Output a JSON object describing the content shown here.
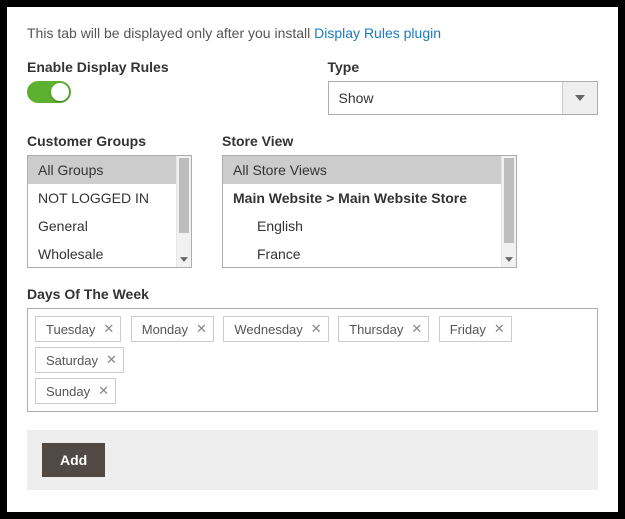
{
  "intro": {
    "text_before": "This tab will be displayed only after you install ",
    "link_text": "Display Rules plugin"
  },
  "enable": {
    "label": "Enable Display Rules"
  },
  "type": {
    "label": "Type",
    "value": "Show"
  },
  "customer_groups": {
    "label": "Customer Groups",
    "items": [
      "All Groups",
      "NOT LOGGED IN",
      "General",
      "Wholesale"
    ]
  },
  "store_view": {
    "label": "Store View",
    "items": [
      {
        "text": "All Store Views",
        "selected": true
      },
      {
        "text": "Main Website > Main Website Store",
        "bold": true
      },
      {
        "text": "English",
        "indent": true
      },
      {
        "text": "France",
        "indent": true
      }
    ]
  },
  "days": {
    "label": "Days Of The Week",
    "tags": [
      "Tuesday",
      "Monday",
      "Wednesday",
      "Thursday",
      "Friday",
      "Saturday",
      "Sunday"
    ]
  },
  "add_button": "Add"
}
